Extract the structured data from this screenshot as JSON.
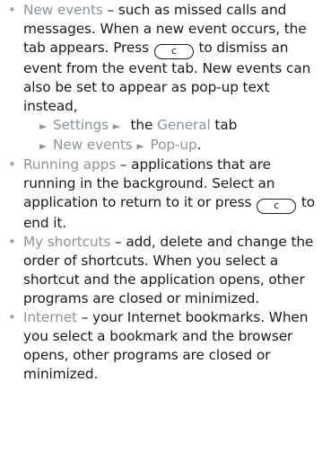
{
  "items": [
    {
      "term": "New events",
      "t1": " – such as missed calls and messages. When a new event occurs, the tab appears. Press ",
      "key": "c",
      "t2": " to dismiss an event from the event tab. New events can also be set to appear as pop-up text instead,",
      "nav1": {
        "a": "Settings",
        "b": " the ",
        "c": "General",
        "d": " tab"
      },
      "nav2": {
        "a": "New events",
        "b": "Pop-up",
        "c": "."
      }
    },
    {
      "term": "Running apps",
      "t1": " – applications that are running in the background. Select an application to return to it or press ",
      "key": "c",
      "t2": " to end it."
    },
    {
      "term": "My shortcuts",
      "t1": " – add, delete and change the order of shortcuts. When you select a shortcut and the application opens, other programs are closed or minimized."
    },
    {
      "term": "Internet",
      "t1": " – your Internet bookmarks. When you select a bookmark and the browser opens, other programs are closed or minimized."
    }
  ],
  "bullet_char": "•",
  "nav_arrow": "►",
  "colors": {
    "text": "#1a1a1a",
    "term": "#8c9499",
    "bullet": "#9aa3a8"
  }
}
